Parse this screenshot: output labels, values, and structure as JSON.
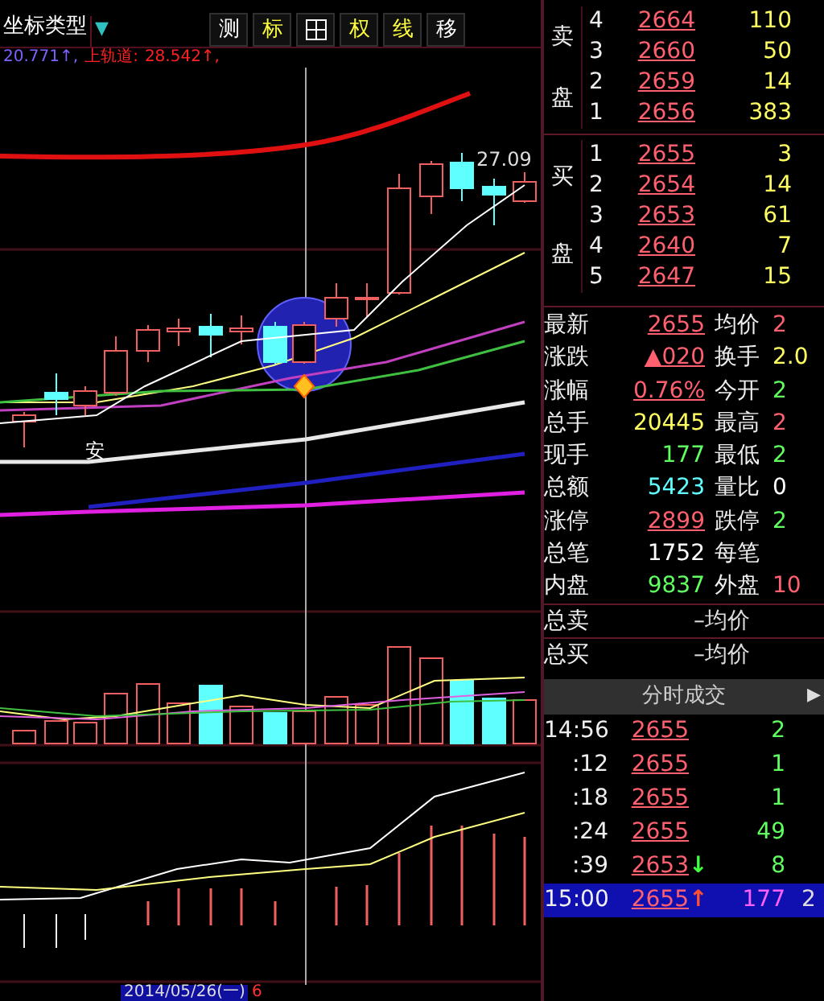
{
  "toolbar": {
    "coord_type": "坐标类型",
    "dropdown": "▼",
    "buttons": [
      {
        "kind": "text",
        "label": "测",
        "color": "#ffffff"
      },
      {
        "kind": "text",
        "label": "标",
        "color": "#ffff40"
      },
      {
        "kind": "grid"
      },
      {
        "kind": "text",
        "label": "权",
        "color": "#ffff40"
      },
      {
        "kind": "text",
        "label": "线",
        "color": "#ffff40"
      },
      {
        "kind": "text",
        "label": "移",
        "color": "#ffffff"
      }
    ]
  },
  "indicator": [
    {
      "text": "20.771↑,",
      "color": "#8060ff"
    },
    {
      "text": "上轨道:",
      "color": "#ff2020"
    },
    {
      "text": "28.542↑,",
      "color": "#ff2020"
    }
  ],
  "chart": {
    "price_label": "27.09",
    "signal_label": "安",
    "date": "2014/05/26(一)",
    "date_suffix": "6"
  },
  "order_book": {
    "sell_label": [
      "卖",
      "盘"
    ],
    "buy_label": [
      "买",
      "盘"
    ],
    "sell": [
      {
        "rank": "4",
        "price": "2664",
        "volume": "110"
      },
      {
        "rank": "3",
        "price": "2660",
        "volume": "50"
      },
      {
        "rank": "2",
        "price": "2659",
        "volume": "14"
      },
      {
        "rank": "1",
        "price": "2656",
        "volume": "383"
      }
    ],
    "buy": [
      {
        "rank": "1",
        "price": "2655",
        "volume": "3"
      },
      {
        "rank": "2",
        "price": "2654",
        "volume": "14"
      },
      {
        "rank": "3",
        "price": "2653",
        "volume": "61"
      },
      {
        "rank": "4",
        "price": "2640",
        "volume": "7"
      },
      {
        "rank": "5",
        "price": "2647",
        "volume": "15"
      }
    ]
  },
  "stats": [
    {
      "left": {
        "label": "最新",
        "value": "2655",
        "color": "#ff6070"
      },
      "right": {
        "label": "均价",
        "value": "2",
        "color": "#ff6070"
      }
    },
    {
      "left": {
        "label": "涨跌",
        "value": "▲020",
        "color": "#ff6070"
      },
      "right": {
        "label": "换手",
        "value": "2.0",
        "color": "#ffff60"
      }
    },
    {
      "left": {
        "label": "涨幅",
        "value": "0.76%",
        "color": "#ff6070"
      },
      "right": {
        "label": "今开",
        "value": "2",
        "color": "#60ff60"
      }
    },
    {
      "left": {
        "label": "总手",
        "value": "20445",
        "color": "#ffff60"
      },
      "right": {
        "label": "最高",
        "value": "2",
        "color": "#ff6070"
      }
    },
    {
      "left": {
        "label": "现手",
        "value": "177",
        "color": "#60ff60"
      },
      "right": {
        "label": "最低",
        "value": "2",
        "color": "#60ff60"
      }
    },
    {
      "left": {
        "label": "总额",
        "value": "5423",
        "color": "#60ffff"
      },
      "right": {
        "label": "量比",
        "value": "0",
        "color": "#ffffff"
      }
    },
    {
      "left": {
        "label": "涨停",
        "value": "2899",
        "color": "#ff6070"
      },
      "right": {
        "label": "跌停",
        "value": "2",
        "color": "#60ff60"
      }
    },
    {
      "left": {
        "label": "总笔",
        "value": "1752",
        "color": "#ffffff"
      },
      "right": {
        "label": "每笔"
      }
    },
    {
      "left": {
        "label": "内盘",
        "value": "9837",
        "color": "#60ff60"
      },
      "right": {
        "label": "外盘",
        "value": "10",
        "color": "#ff6070"
      }
    }
  ],
  "totals": [
    {
      "label": "总卖",
      "value": "–",
      "label2": "均价"
    },
    {
      "label": "总买",
      "value": "–",
      "label2": "均价"
    }
  ],
  "trades": {
    "title": "分时成交",
    "arrow": "▶",
    "rows": [
      {
        "time": "14:56",
        "price": "2655",
        "volume": "2",
        "selected": false
      },
      {
        "time": ":12",
        "price": "2655",
        "volume": "1",
        "selected": false
      },
      {
        "time": ":18",
        "price": "2655",
        "volume": "1",
        "selected": false
      },
      {
        "time": ":24",
        "price": "2655",
        "volume": "49",
        "selected": false
      },
      {
        "time": ":39",
        "price": "2653",
        "mark": "↓",
        "kind": "down",
        "volume": "8",
        "selected": false
      },
      {
        "time": "15:00",
        "price": "2655",
        "mark": "↑",
        "kind": "up",
        "volume": "177",
        "tail": "2",
        "selected": true
      }
    ]
  }
}
